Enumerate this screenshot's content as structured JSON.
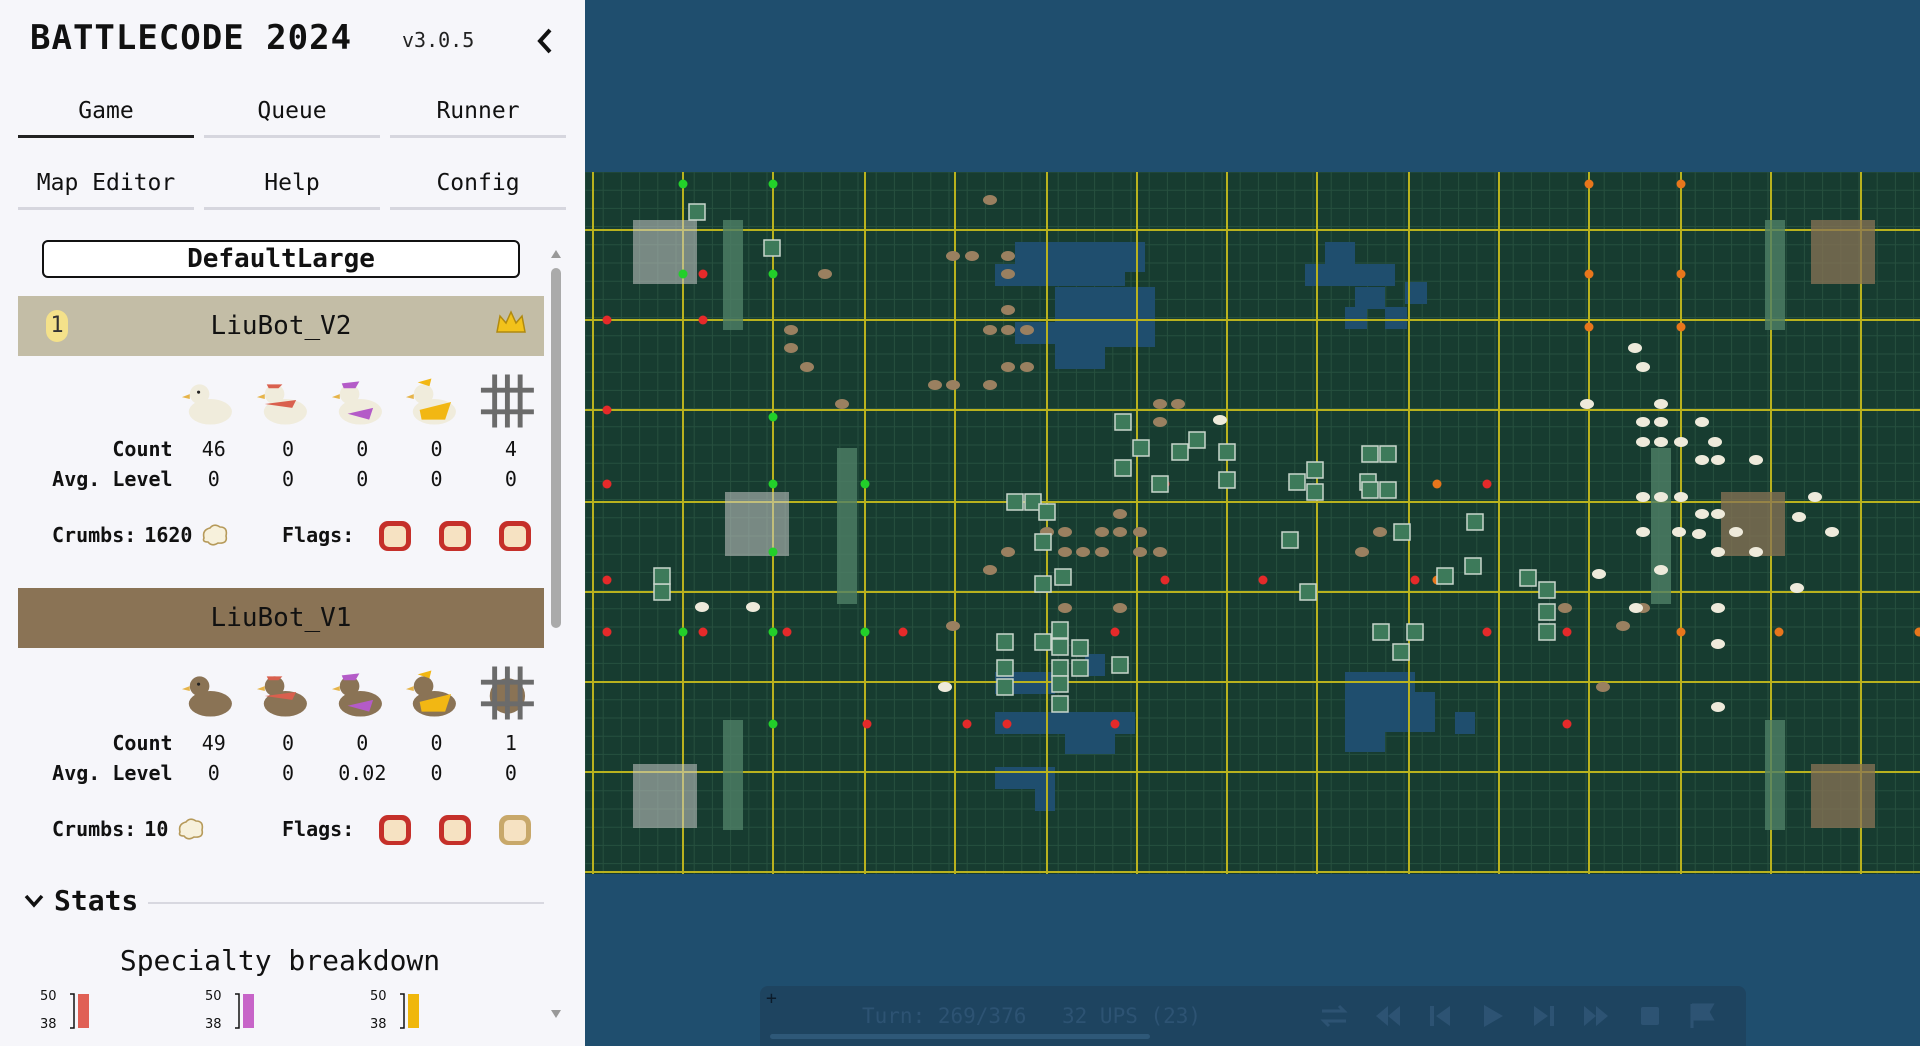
{
  "app": {
    "title": "BATTLECODE 2024",
    "version": "v3.0.5"
  },
  "tabs": [
    "Game",
    "Queue",
    "Runner",
    "Map Editor",
    "Help",
    "Config"
  ],
  "active_tab": "Game",
  "map_name": "DefaultLarge",
  "teams": [
    {
      "rank": "1",
      "name": "LiuBot_V2",
      "count_label": "Count",
      "level_label": "Avg. Level",
      "counts": [
        "46",
        "0",
        "0",
        "0",
        "4"
      ],
      "levels": [
        "0",
        "0",
        "0",
        "0",
        "0"
      ],
      "crumbs_label": "Crumbs:",
      "crumbs": "1620",
      "flags_label": "Flags:",
      "color": "#c3bda6"
    },
    {
      "name": "LiuBot_V1",
      "count_label": "Count",
      "level_label": "Avg. Level",
      "counts": [
        "49",
        "0",
        "0",
        "0",
        "1"
      ],
      "levels": [
        "0",
        "0",
        "0.02",
        "0",
        "0"
      ],
      "crumbs_label": "Crumbs:",
      "crumbs": "10",
      "flags_label": "Flags:",
      "color": "#8a7355"
    }
  ],
  "stats": {
    "header": "Stats",
    "chart_title": "Specialty breakdown",
    "axis_top": "50",
    "axis_bottom": "38"
  },
  "controls": {
    "turn": "Turn: 269/376",
    "ups": "32 UPS (23)",
    "plus": "+"
  },
  "colors": {
    "map_bg": "#173c30",
    "grid_major": "#b9b21e",
    "water": "#1f4e6e",
    "sidebar": "#f6f6fa"
  },
  "icons": [
    "collapse-chevron-icon",
    "crown-icon",
    "crumb-icon",
    "flag-icon",
    "swap-icon",
    "rewind-icon",
    "step-back-icon",
    "play-icon",
    "step-forward-icon",
    "fast-forward-icon",
    "stop-icon",
    "flag-end-icon"
  ]
}
